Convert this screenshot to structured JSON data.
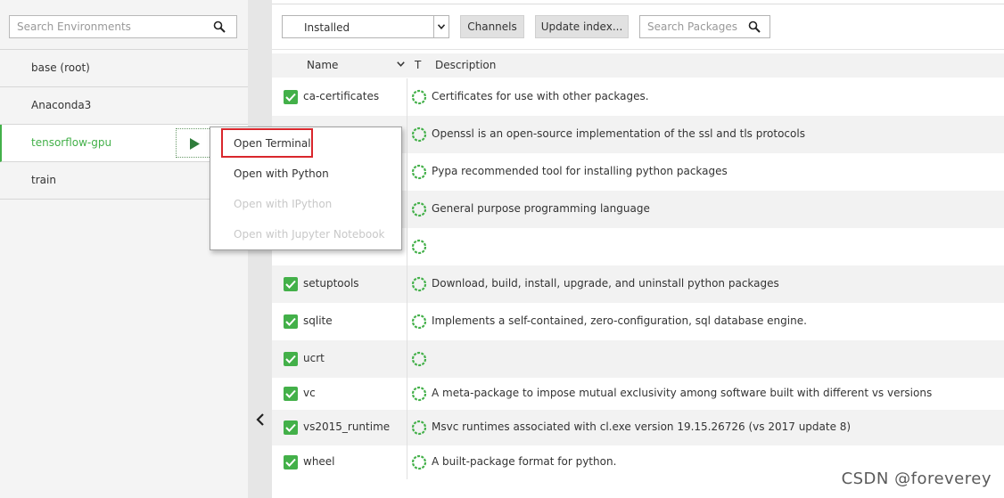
{
  "environments": {
    "search": {
      "placeholder": "Search Environments",
      "icon": "search-icon"
    },
    "items": [
      {
        "label": "base (root)",
        "active": false
      },
      {
        "label": "Anaconda3",
        "active": false
      },
      {
        "label": "tensorflow-gpu",
        "active": true
      },
      {
        "label": "train",
        "active": false
      }
    ],
    "play_icon": "play-icon"
  },
  "context_menu": {
    "items": [
      {
        "label": "Open Terminal",
        "enabled": true,
        "highlighted": true
      },
      {
        "label": "Open with Python",
        "enabled": true
      },
      {
        "label": "Open with IPython",
        "enabled": false
      },
      {
        "label": "Open with Jupyter Notebook",
        "enabled": false
      }
    ],
    "highlight_color": "#d9262c"
  },
  "toolbar": {
    "filter_value": "Installed",
    "channels_label": "Channels",
    "update_label": "Update index...",
    "search_placeholder": "Search Packages"
  },
  "table": {
    "headers": {
      "name": "Name",
      "type": "T",
      "description": "Description"
    },
    "rows": [
      {
        "name": "ca-certificates",
        "description": "Certificates for use with other packages."
      },
      {
        "name": "",
        "description": "Openssl is an open-source implementation of the ssl and tls protocols"
      },
      {
        "name": "",
        "description": "Pypa recommended tool for installing python packages"
      },
      {
        "name": "",
        "description": "General purpose programming language"
      },
      {
        "name": "",
        "description": ""
      },
      {
        "name": "setuptools",
        "description": "Download, build, install, upgrade, and uninstall python packages"
      },
      {
        "name": "sqlite",
        "description": "Implements a self-contained, zero-configuration, sql database engine."
      },
      {
        "name": "ucrt",
        "description": ""
      },
      {
        "name": "vc",
        "description": "A meta-package to impose mutual exclusivity among software built with different vs versions"
      },
      {
        "name": "vs2015_runtime",
        "description": "Msvc runtimes associated with cl.exe version 19.15.26726 (vs 2017 update 8)"
      },
      {
        "name": "wheel",
        "description": "A built-package format for python."
      }
    ]
  },
  "colors": {
    "accent": "#43b049",
    "status_ring": "#43b049",
    "row_alt": "#f2f2f2"
  },
  "watermark": "CSDN @foreverey"
}
